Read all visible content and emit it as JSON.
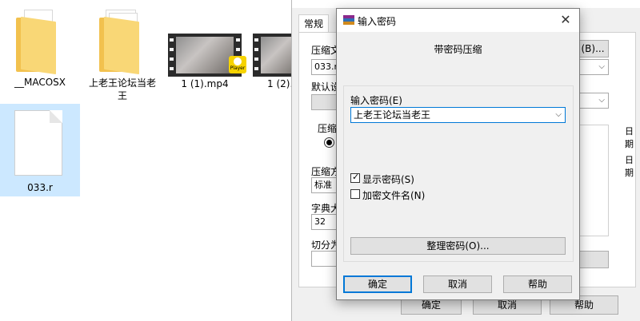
{
  "desktop": {
    "files": [
      {
        "name": "__MACOSX",
        "type": "folder"
      },
      {
        "name": "上老王论坛当老王",
        "type": "folder"
      },
      {
        "name": "1 (1).mp4",
        "type": "video",
        "badge": "Player"
      },
      {
        "name": "1 (2).",
        "type": "video"
      },
      {
        "name": "033.r",
        "type": "file",
        "selected": true
      }
    ]
  },
  "background_window": {
    "tab_general": "常规",
    "label_archive": "压缩文",
    "archive_value": "033.r",
    "browse_button": "(B)...",
    "label_default": "默认设",
    "label_compress": "压缩",
    "label_method": "压缩方",
    "method_value": "标准",
    "label_dict": "字典大",
    "dict_value": "32",
    "label_split": "切分为",
    "right_text_1": "日期",
    "right_text_2": ":",
    "right_text_3": "日期",
    "right_paren": ")",
    "ok_button": "确定",
    "cancel_button": "取消",
    "help_button": "帮助"
  },
  "dialog": {
    "title": "输入密码",
    "heading": "带密码压缩",
    "password_label": "输入密码(E)",
    "password_value": "上老王论坛当老王",
    "show_password_label": "显示密码(S)",
    "show_password_checked": true,
    "encrypt_names_label": "加密文件名(N)",
    "encrypt_names_checked": false,
    "organize_button": "整理密码(O)...",
    "ok_button": "确定",
    "cancel_button": "取消",
    "help_button": "帮助"
  },
  "colors": {
    "folder": "#f2c14e",
    "selection": "#cce8ff",
    "focus": "#0078d7"
  }
}
